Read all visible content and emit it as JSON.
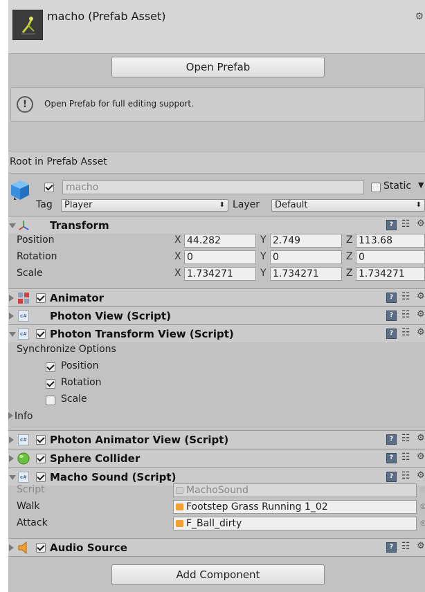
{
  "header": {
    "title": "macho (Prefab Asset)",
    "gear_glyph": "⚙"
  },
  "prefab": {
    "open_button": "Open Prefab",
    "help_text": "Open Prefab for full editing support.",
    "root_label": "Root in Prefab Asset"
  },
  "gameobject": {
    "active": true,
    "name": "macho",
    "static_label": "Static",
    "static_checked": false,
    "tag_label": "Tag",
    "tag_value": "Player",
    "layer_label": "Layer",
    "layer_value": "Default"
  },
  "transform": {
    "title": "Transform",
    "rows": [
      {
        "label": "Position",
        "x": "44.282",
        "y": "2.749",
        "z": "113.68"
      },
      {
        "label": "Rotation",
        "x": "0",
        "y": "0",
        "z": "0"
      },
      {
        "label": "Scale",
        "x": "1.734271",
        "y": "1.734271",
        "z": "1.734271"
      }
    ],
    "axis_x": "X",
    "axis_y": "Y",
    "axis_z": "Z"
  },
  "components": {
    "animator": "Animator",
    "photon_view": "Photon View (Script)",
    "photon_transform_view": "Photon Transform View (Script)",
    "photon_animator_view": "Photon Animator View (Script)",
    "sphere_collider": "Sphere Collider",
    "macho_sound": "Macho Sound (Script)",
    "audio_source": "Audio Source"
  },
  "photon_transform": {
    "sync_label": "Synchronize Options",
    "position": "Position",
    "rotation": "Rotation",
    "scale": "Scale",
    "position_checked": true,
    "rotation_checked": true,
    "scale_checked": false,
    "info": "Info"
  },
  "macho_sound": {
    "script_label": "Script",
    "script_value": "MachoSound",
    "walk_label": "Walk",
    "walk_value": "Footstep Grass Running 1_02",
    "attack_label": "Attack",
    "attack_value": "F_Ball_dirty"
  },
  "footer": {
    "add_component": "Add Component"
  },
  "icons": {
    "help_glyph": "!",
    "book_glyph": "?",
    "preset_glyph": "☷",
    "gear_glyph": "⚙",
    "dropdown_glyph": "⬍",
    "static_arrow": "▼",
    "picker_glyph": "◎",
    "cs_glyph": "c#"
  },
  "colors": {
    "panel_bg": "#c2c2c2",
    "header_bg": "#cbcbcb",
    "audio_icon": "#f0a030",
    "collider_icon": "#6cc040",
    "cube_icon": "#3a8fe0"
  }
}
